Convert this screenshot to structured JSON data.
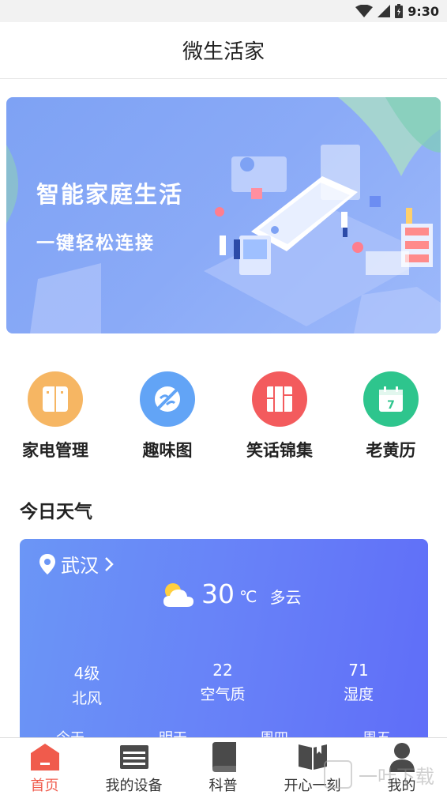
{
  "status_bar": {
    "time": "9:30"
  },
  "header": {
    "title": "微生活家"
  },
  "banner": {
    "title": "智能家庭生活",
    "subtitle": "一键轻松连接"
  },
  "quick_actions": [
    {
      "label": "家电管理",
      "icon": "appliance-icon",
      "color": "#f6b663"
    },
    {
      "label": "趣味图",
      "icon": "picture-icon",
      "color": "#62a4f6"
    },
    {
      "label": "笑话锦集",
      "icon": "bookshelf-icon",
      "color": "#f35b5d"
    },
    {
      "label": "老黄历",
      "icon": "calendar-icon",
      "color": "#2ec58d"
    }
  ],
  "weather": {
    "heading": "今日天气",
    "city": "武汉",
    "temperature": "30",
    "unit": "℃",
    "condition": "多云",
    "stats": [
      {
        "value": "4级",
        "label": "北风"
      },
      {
        "value": "22",
        "label": "空气质"
      },
      {
        "value": "71",
        "label": "湿度"
      }
    ],
    "forecast_days": [
      "今天",
      "明天",
      "周四",
      "周五"
    ]
  },
  "tabs": [
    {
      "label": "首页",
      "icon": "home-icon",
      "active": true
    },
    {
      "label": "我的设备",
      "icon": "devices-icon",
      "active": false
    },
    {
      "label": "科普",
      "icon": "book-icon",
      "active": false
    },
    {
      "label": "开心一刻",
      "icon": "open-book-icon",
      "active": false
    },
    {
      "label": "我的",
      "icon": "person-icon",
      "active": false
    }
  ],
  "watermark": {
    "text": "一叶下载"
  },
  "colors": {
    "accent": "#f05b4c",
    "weather_gradient_start": "#6b96f6",
    "weather_gradient_end": "#5f6df8"
  }
}
